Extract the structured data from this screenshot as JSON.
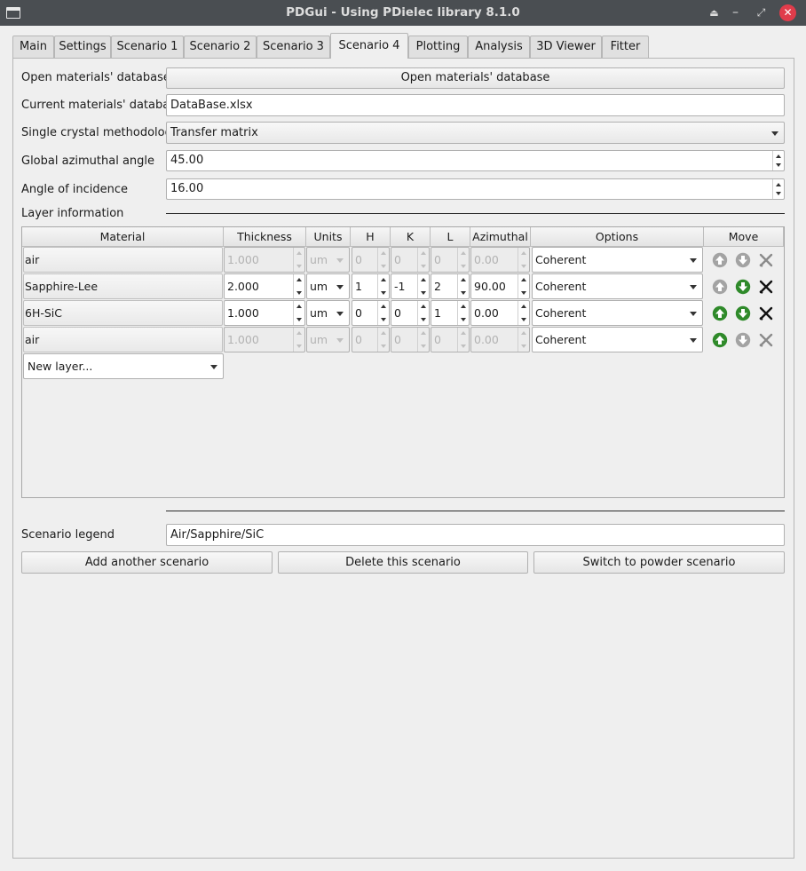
{
  "window": {
    "title": "PDGui - Using PDielec library 8.1.0"
  },
  "tabs": [
    "Main",
    "Settings",
    "Scenario 1",
    "Scenario 2",
    "Scenario 3",
    "Scenario 4",
    "Plotting",
    "Analysis",
    "3D Viewer",
    "Fitter"
  ],
  "active_tab": "Scenario 4",
  "form": {
    "open_db_label": "Open materials' database",
    "open_db_button": "Open materials' database",
    "current_db_label": "Current materials' database",
    "current_db_value": "DataBase.xlsx",
    "methodology_label": "Single crystal methodology",
    "methodology_value": "Transfer matrix",
    "azimuthal_label": "Global azimuthal angle",
    "azimuthal_value": "45.00",
    "incidence_label": "Angle of incidence",
    "incidence_value": "16.00",
    "layer_info_label": "Layer information"
  },
  "layer_table": {
    "headers": [
      "Material",
      "Thickness",
      "Units",
      "H",
      "K",
      "L",
      "Azimuthal",
      "Options",
      "Move"
    ],
    "rows": [
      {
        "material": "air",
        "thickness": "1.000",
        "units": "um",
        "h": "0",
        "k": "0",
        "l": "0",
        "azimuthal": "0.00",
        "options": "Coherent",
        "disabled": true,
        "up_enabled": false,
        "down_enabled": false
      },
      {
        "material": "Sapphire-Lee",
        "thickness": "2.000",
        "units": "um",
        "h": "1",
        "k": "-1",
        "l": "2",
        "azimuthal": "90.00",
        "options": "Coherent",
        "disabled": false,
        "up_enabled": false,
        "down_enabled": true
      },
      {
        "material": "6H-SiC",
        "thickness": "1.000",
        "units": "um",
        "h": "0",
        "k": "0",
        "l": "1",
        "azimuthal": "0.00",
        "options": "Coherent",
        "disabled": false,
        "up_enabled": true,
        "down_enabled": true
      },
      {
        "material": "air",
        "thickness": "1.000",
        "units": "um",
        "h": "0",
        "k": "0",
        "l": "0",
        "azimuthal": "0.00",
        "options": "Coherent",
        "disabled": true,
        "up_enabled": true,
        "down_enabled": false
      }
    ],
    "new_layer": "New layer..."
  },
  "legend": {
    "label": "Scenario legend",
    "value": "Air/Sapphire/SiC"
  },
  "buttons": {
    "add": "Add another scenario",
    "delete": "Delete this scenario",
    "switch": "Switch to powder scenario"
  },
  "colors": {
    "arrow_enabled": "#2f8a2a",
    "arrow_disabled": "#a3a3a3",
    "close_button": "#e03c4b",
    "titlebar": "#4a4e52"
  }
}
